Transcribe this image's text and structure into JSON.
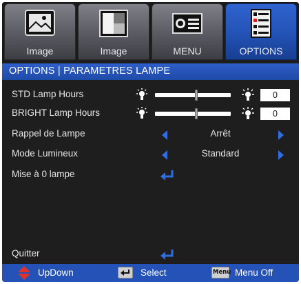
{
  "tabs": [
    {
      "label": "Image",
      "icon": "image-landscape-icon",
      "active": false
    },
    {
      "label": "Image",
      "icon": "image-contrast-icon",
      "active": false
    },
    {
      "label": "MENU",
      "icon": "projector-icon",
      "active": false
    },
    {
      "label": "OPTIONS",
      "icon": "options-checklist-icon",
      "active": true
    }
  ],
  "title": "OPTIONS | PARAMETRES LAMPE",
  "rows": {
    "std_lamp_hours": {
      "label": "STD Lamp Hours",
      "value": "0"
    },
    "bright_lamp_hours": {
      "label": "BRIGHT Lamp Hours",
      "value": "0"
    },
    "rappel": {
      "label": "Rappel de Lampe",
      "value": "Arrêt"
    },
    "mode": {
      "label": "Mode Lumineux",
      "value": "Standard"
    },
    "reset": {
      "label": "Mise à 0 lampe"
    },
    "quit": {
      "label": "Quitter"
    }
  },
  "footer": {
    "updown": "UpDown",
    "select": "Select",
    "menu_key": "Menu",
    "menu_off": "Menu Off"
  },
  "colors": {
    "accent": "#2452b6",
    "arrow": "#2f6de0",
    "panel": "#1e1e1e"
  }
}
